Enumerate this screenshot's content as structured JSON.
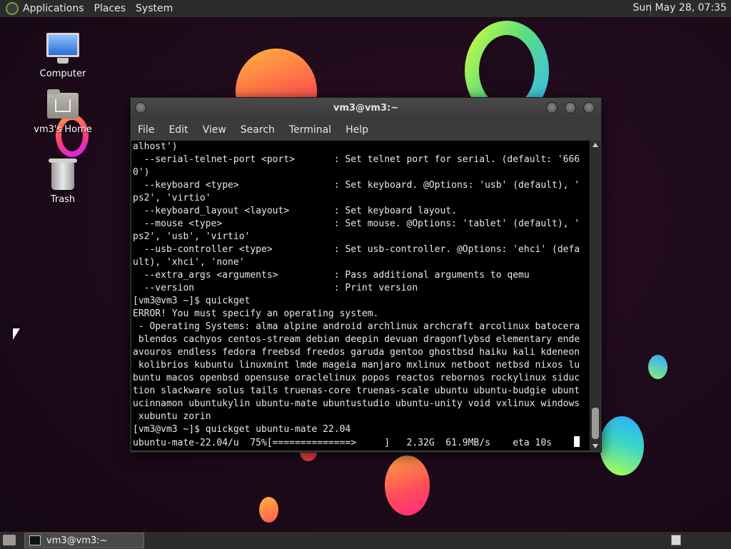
{
  "top_panel": {
    "menus": [
      "Applications",
      "Places",
      "System"
    ],
    "clock": "Sun May 28, 07:35"
  },
  "desktop": {
    "icons": [
      {
        "label": "Computer",
        "icon": "computer-icon"
      },
      {
        "label": "vm3's Home",
        "icon": "home-folder-icon"
      },
      {
        "label": "Trash",
        "icon": "trash-icon"
      }
    ]
  },
  "terminal": {
    "title": "vm3@vm3:~",
    "menus": [
      "File",
      "Edit",
      "View",
      "Search",
      "Terminal",
      "Help"
    ],
    "lines": [
      "alhost')",
      "  --serial-telnet-port <port>       : Set telnet port for serial. (default: '666",
      "0')",
      "  --keyboard <type>                 : Set keyboard. @Options: 'usb' (default), '",
      "ps2', 'virtio'",
      "  --keyboard_layout <layout>        : Set keyboard layout.",
      "  --mouse <type>                    : Set mouse. @Options: 'tablet' (default), '",
      "ps2', 'usb', 'virtio'",
      "  --usb-controller <type>           : Set usb-controller. @Options: 'ehci' (defa",
      "ult), 'xhci', 'none'",
      "  --extra_args <arguments>          : Pass additional arguments to qemu",
      "  --version                         : Print version",
      "[vm3@vm3 ~]$ quickget",
      "ERROR! You must specify an operating system.",
      " - Operating Systems: alma alpine android archlinux archcraft arcolinux batocera",
      " blendos cachyos centos-stream debian deepin devuan dragonflybsd elementary ende",
      "avouros endless fedora freebsd freedos garuda gentoo ghostbsd haiku kali kdeneon",
      " kolibrios kubuntu linuxmint lmde mageia manjaro mxlinux netboot netbsd nixos lu",
      "buntu macos openbsd opensuse oraclelinux popos reactos rebornos rockylinux siduc",
      "tion slackware solus tails truenas-core truenas-scale ubuntu ubuntu-budgie ubunt",
      "ucinnamon ubuntukylin ubuntu-mate ubuntustudio ubuntu-unity void vxlinux windows",
      " xubuntu zorin",
      "[vm3@vm3 ~]$ quickget ubuntu-mate 22.04"
    ],
    "progress_line": "ubuntu-mate-22.04/u  75%[==============>     ]   2.32G  61.9MB/s    eta 10s    "
  },
  "taskbar": {
    "task_label": "vm3@vm3:~"
  },
  "colors": {
    "panel": "#2b2b2b",
    "terminal_bg": "#000000",
    "terminal_fg": "#e8e8e8"
  }
}
